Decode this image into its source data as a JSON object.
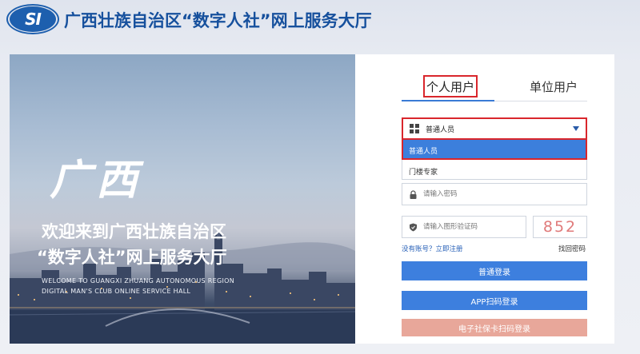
{
  "header": {
    "logo_text": "SI",
    "title": "广西壮族自治区“数字人社”网上服务大厅"
  },
  "hero": {
    "calligraphy": "广西",
    "welcome_line1": "欢迎来到广西壮族自治区",
    "welcome_line2": "“数字人社”网上服务大厅",
    "english_line1": "WELCOME TO GUANGXI ZHUANG AUTONOMOUS REGION",
    "english_line2": "DIGITAL MAN'S CLUB ONLINE SERVICE HALL"
  },
  "login": {
    "tabs": [
      {
        "label": "个人用户",
        "active": true
      },
      {
        "label": "单位用户",
        "active": false
      }
    ],
    "user_type": {
      "selected": "普通人员",
      "options": [
        "普通人员",
        "门楼专家"
      ]
    },
    "password_placeholder": "请输入密码",
    "captcha_placeholder": "请输入图形验证码",
    "captcha_code": "852",
    "register_link": "没有账号？立即注册",
    "forgot_link": "找回密码",
    "buttons": {
      "normal_login": "普通登录",
      "app_scan_login": "APP扫码登录",
      "ecard_scan_login": "电子社保卡扫码登录"
    }
  },
  "colors": {
    "brand_blue": "#16509d",
    "button_blue": "#3d7fde",
    "highlight_red": "#d9262c",
    "ecard_button": "#e8a79a"
  }
}
